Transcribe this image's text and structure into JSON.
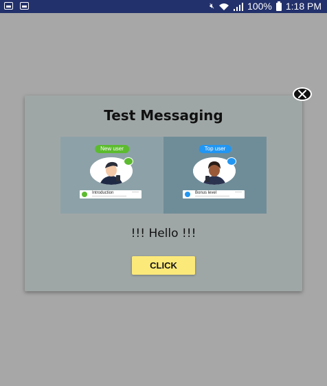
{
  "status_bar": {
    "time": "1:18 PM",
    "battery_percent": "100%",
    "icons": [
      "image-notification-icon",
      "news-notification-icon",
      "mute-icon",
      "wifi-icon",
      "signal-icon",
      "battery-icon"
    ]
  },
  "dialog": {
    "title": "Test Messaging",
    "message": "!!! Hello !!!",
    "button_label": "CLICK",
    "close_icon": "close-icon",
    "hero": {
      "left": {
        "pill_label": "New user",
        "pill_color": "#5cbb2f",
        "card_label": "Introduction",
        "badge_color": "#5cbb2f"
      },
      "right": {
        "pill_label": "Top user",
        "pill_color": "#2196f3",
        "card_label": "Bonus level",
        "badge_color": "#2196f3"
      }
    }
  },
  "colors": {
    "status_bar": "#22306b",
    "backdrop": "#a7a7a7",
    "dialog": "#9fa7a6",
    "button": "#fbe97a"
  }
}
